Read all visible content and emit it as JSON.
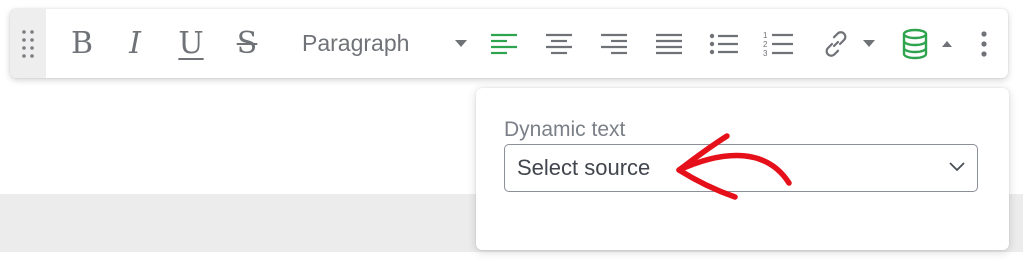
{
  "toolbar": {
    "paragraph_select": {
      "label": "Paragraph"
    },
    "accent_color": "#2ea44f",
    "icon_color": "#6f7277",
    "buttons": [
      {
        "name": "bold",
        "icon": "bold-icon",
        "glyph": "B"
      },
      {
        "name": "italic",
        "icon": "italic-icon",
        "glyph": "I"
      },
      {
        "name": "underline",
        "icon": "underline-icon",
        "glyph": "U"
      },
      {
        "name": "strikethrough",
        "icon": "strikethrough-icon",
        "glyph": "S"
      },
      {
        "name": "align-left",
        "icon": "align-left-icon",
        "active": true
      },
      {
        "name": "align-center",
        "icon": "align-center-icon"
      },
      {
        "name": "align-right",
        "icon": "align-right-icon"
      },
      {
        "name": "align-justify",
        "icon": "align-justify-icon"
      },
      {
        "name": "bulleted-list",
        "icon": "bulleted-list-icon"
      },
      {
        "name": "numbered-list",
        "icon": "numbered-list-icon",
        "numerals": [
          "1",
          "2",
          "3"
        ]
      },
      {
        "name": "link",
        "icon": "link-icon"
      },
      {
        "name": "dynamic-data",
        "icon": "database-icon",
        "active": true
      },
      {
        "name": "more-options",
        "icon": "more-vertical-icon"
      }
    ]
  },
  "popover": {
    "label": "Dynamic text",
    "select": {
      "value": "Select source"
    }
  },
  "annotation": {
    "arrow_color": "#e5101a"
  }
}
